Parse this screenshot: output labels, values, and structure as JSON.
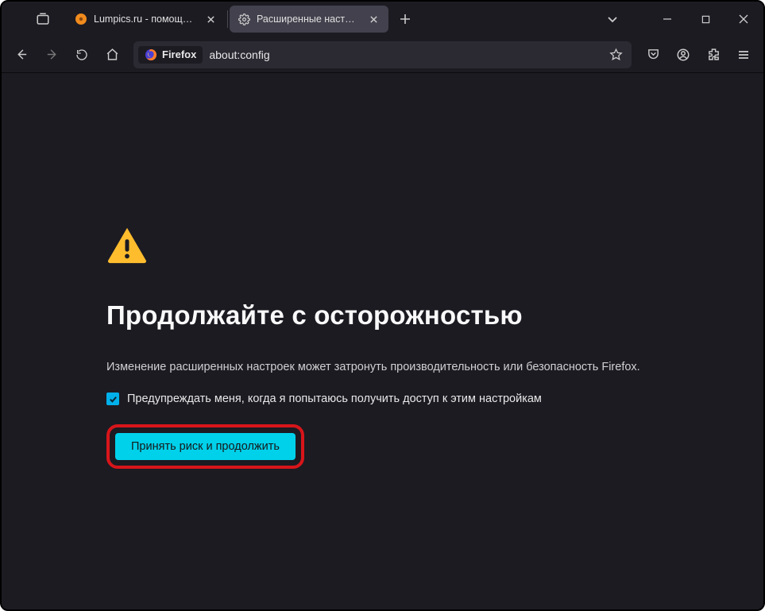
{
  "tabs": [
    {
      "label": "Lumpics.ru - помощь с компьютерами",
      "active": false
    },
    {
      "label": "Расширенные настройки",
      "active": true
    }
  ],
  "urlbar": {
    "identity_label": "Firefox",
    "url": "about:config"
  },
  "warning": {
    "title": "Продолжайте с осторожностью",
    "description": "Изменение расширенных настроек может затронуть производительность или безопасность Firefox.",
    "checkbox_label": "Предупреждать меня, когда я попытаюсь получить доступ к этим настройкам",
    "accept_button": "Принять риск и продолжить"
  }
}
